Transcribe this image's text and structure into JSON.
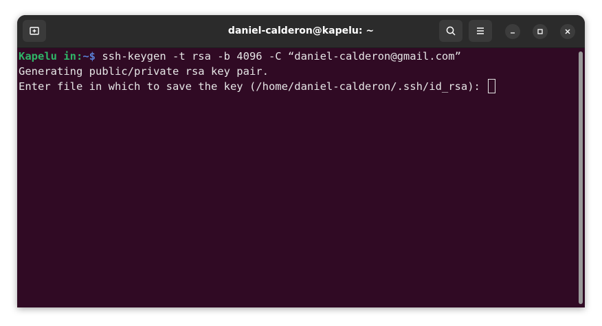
{
  "window": {
    "title": "daniel-calderon@kapelu: ~"
  },
  "titlebar_buttons": {
    "new_tab_icon": "new-tab-icon",
    "search_icon": "search-icon",
    "menu_icon": "hamburger-menu-icon",
    "minimize_icon": "minimize-icon",
    "maximize_icon": "maximize-icon",
    "close_icon": "close-icon"
  },
  "terminal": {
    "prompt_user": "Kapelu in:",
    "prompt_path": "~$",
    "command": " ssh-keygen -t rsa -b 4096 -C “daniel-calderon@gmail.com”",
    "output_line1": "Generating public/private rsa key pair.",
    "output_line2": "Enter file in which to save the key (/home/daniel-calderon/.ssh/id_rsa): "
  },
  "colors": {
    "terminal_background": "#300a24",
    "titlebar_background": "#2b2b2b",
    "prompt_user": "#2fb567",
    "prompt_path": "#5a7fd6",
    "text": "#e6e6e6"
  }
}
